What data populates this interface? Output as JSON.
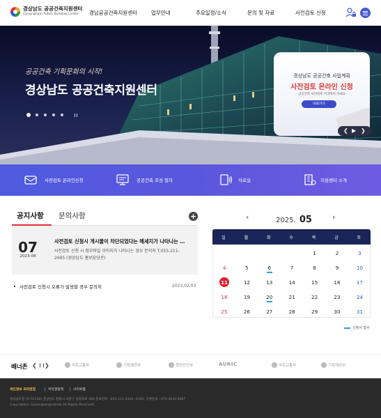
{
  "header": {
    "logo_title": "경상남도 공공건축지원센터",
    "logo_sub": "Gyeongnam Public Building Center",
    "nav": [
      "경남공공건축지원센터",
      "업무안내",
      "주요일정/소식",
      "문의 및 자료",
      "사전검토 신청"
    ],
    "user_icon": "user-lock-icon",
    "menu_icon": "hamburger-icon"
  },
  "hero": {
    "slogan": "공공건축 기획문화의 시작!",
    "title": "경상남도 공공건축지원센터",
    "slide_count": 5,
    "active_slide": 1,
    "popup": {
      "line1": "경상남도 공공건축 사업계획",
      "line2": "사전검토 온라인 신청",
      "line3": "공공건축 사전검토 이곳에서 하세요",
      "button": "바로가기"
    },
    "controls": {
      "prev": "❮",
      "play": "▶",
      "next": "❯"
    }
  },
  "quick_links": [
    {
      "label": "사전검토 온라인신청",
      "icon": "mail-icon"
    },
    {
      "label": "공공건축 조성 절차",
      "icon": "monitor-icon"
    },
    {
      "label": "자료실",
      "icon": "sound-document-icon"
    },
    {
      "label": "지원센터 소개",
      "icon": "building-info-icon"
    }
  ],
  "notice": {
    "tabs": [
      "공지사항",
      "문의사항"
    ],
    "more": "+",
    "featured": {
      "day": "07",
      "date": "2023-06",
      "title": "사전검토 신청시 게시물이 차단되었다는 메세지가 나타나는 …",
      "desc": "사전검토 신청 시 첨부파일 이미지가 나타나는 경우 문의처  T.055-211-2685 (경상남도 홍보담당관)"
    },
    "items": [
      {
        "title": "사전검토 신청시 오류가 발생할 경우 문의처",
        "date": "2023.02.03"
      }
    ]
  },
  "calendar": {
    "year": "2025.",
    "month": "05",
    "prev": "‹",
    "next": "›",
    "weekdays": [
      "일",
      "월",
      "화",
      "수",
      "목",
      "금",
      "토"
    ],
    "weeks": [
      [
        "",
        "",
        "",
        "",
        "1",
        "2",
        "3"
      ],
      [
        "4",
        "5",
        "6",
        "7",
        "8",
        "9",
        "10"
      ],
      [
        "11",
        "12",
        "13",
        "14",
        "15",
        "16",
        "17"
      ],
      [
        "18",
        "19",
        "20",
        "21",
        "22",
        "23",
        "24"
      ],
      [
        "25",
        "26",
        "27",
        "28",
        "29",
        "30",
        "31"
      ]
    ],
    "today": "11",
    "marked_days": [
      "6",
      "20"
    ],
    "legend": "신청서 접수",
    "legend_color": "#2a9be0"
  },
  "banner_zone": {
    "title": "배너존",
    "prev": "❮",
    "pause": "❙❙",
    "next": "❯",
    "logos": [
      "국토교통부",
      "기획재정부",
      "행정안전부",
      "AURIC",
      "국토교통부",
      "기획재정부"
    ]
  },
  "footer": {
    "links": [
      "개인정보 처리방침",
      "저작권정책",
      "사이트맵"
    ],
    "address": "경상남도청 (우 51154) 경상남도 창원시 의창구 중앙대로 300 문의전화 : 055-211-4342~4345, 우편문의 : 070-4633-0087",
    "copyright": "Copyright(c) Gyeongsangnamdo All Rights Reserved."
  },
  "colors": {
    "accent": "#4a5bd6",
    "quick_bar": "#5a57dc",
    "calendar_head": "#1b2558",
    "today": "#e0202e",
    "sunday": "#e0303a",
    "saturday": "#2e55c4"
  }
}
